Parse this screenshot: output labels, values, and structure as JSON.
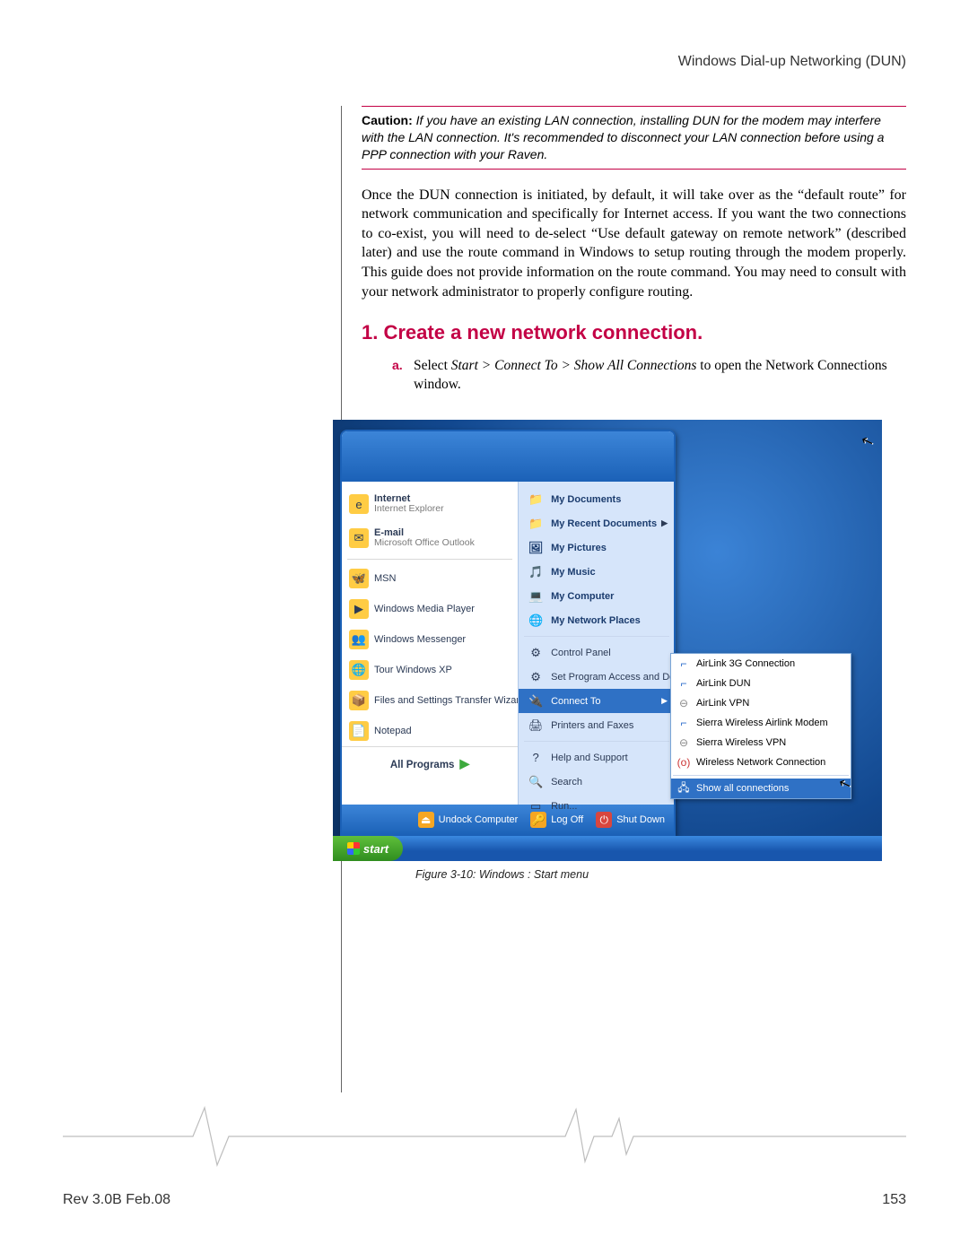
{
  "header": {
    "title": "Windows Dial-up Networking (DUN)"
  },
  "caution": {
    "label": "Caution:",
    "body": "If you have an existing LAN connection, installing DUN for the modem may interfere with the LAN connection. It's recommended to disconnect your LAN connection before using a PPP connection with your Raven."
  },
  "paragraph": "Once the DUN connection is initiated, by default, it will take over as the “default route” for network communication and specifically for Internet access. If you want the two connections to co-exist, you will need to de-select “Use default gateway on remote network” (described later) and use the route command in Windows to setup routing through the modem properly. This guide does not provide information on the route command. You may need to consult with your network administrator to properly configure routing.",
  "section": {
    "number": "1.",
    "title": "Create a new network connection."
  },
  "step_a": {
    "letter": "a.",
    "prefix": "Select ",
    "path": "Start > Connect To > Show All Connections",
    "suffix": " to open the Network Connections window."
  },
  "start_menu": {
    "left_pinned": [
      {
        "title": "Internet",
        "sub": "Internet Explorer",
        "icon": "e"
      },
      {
        "title": "E-mail",
        "sub": "Microsoft Office Outlook",
        "icon": "✉"
      }
    ],
    "left_items": [
      {
        "label": "MSN",
        "icon": "🦋"
      },
      {
        "label": "Windows Media Player",
        "icon": "▶"
      },
      {
        "label": "Windows Messenger",
        "icon": "👥"
      },
      {
        "label": "Tour Windows XP",
        "icon": "🌐"
      },
      {
        "label": "Files and Settings Transfer Wizard",
        "icon": "📦"
      },
      {
        "label": "Notepad",
        "icon": "📄"
      }
    ],
    "all_programs": "All Programs",
    "right_items": [
      {
        "label": "My Documents",
        "bold": true,
        "icon": "📁"
      },
      {
        "label": "My Recent Documents",
        "bold": true,
        "icon": "📁",
        "arrow": true
      },
      {
        "label": "My Pictures",
        "bold": true,
        "icon": "🖼"
      },
      {
        "label": "My Music",
        "bold": true,
        "icon": "🎵"
      },
      {
        "label": "My Computer",
        "bold": true,
        "icon": "💻"
      },
      {
        "label": "My Network Places",
        "bold": true,
        "icon": "🌐"
      },
      {
        "sep": true
      },
      {
        "label": "Control Panel",
        "icon": "⚙"
      },
      {
        "label": "Set Program Access and Defaults",
        "icon": "⚙"
      },
      {
        "label": "Connect To",
        "icon": "🔌",
        "selected": true,
        "arrow": true
      },
      {
        "label": "Printers and Faxes",
        "icon": "🖨"
      },
      {
        "sep": true
      },
      {
        "label": "Help and Support",
        "icon": "?"
      },
      {
        "label": "Search",
        "icon": "🔍"
      },
      {
        "label": "Run...",
        "icon": "▭"
      }
    ],
    "bottom": {
      "undock": "Undock Computer",
      "logoff": "Log Off",
      "shutdown": "Shut Down"
    }
  },
  "flyout": [
    {
      "label": "AirLink 3G Connection",
      "type": "dun"
    },
    {
      "label": "AirLink DUN",
      "type": "dun"
    },
    {
      "label": "AirLink VPN",
      "type": "vpn"
    },
    {
      "label": "Sierra Wireless Airlink Modem",
      "type": "dun"
    },
    {
      "label": "Sierra Wireless VPN",
      "type": "vpn"
    },
    {
      "label": "Wireless Network Connection",
      "type": "wifi"
    },
    {
      "sep": true
    },
    {
      "label": "Show all connections",
      "type": "net",
      "selected": true
    }
  ],
  "start_button": "start",
  "figure_caption": "Figure 3-10:  Windows : Start menu",
  "footer": {
    "rev": "Rev 3.0B Feb.08",
    "page": "153"
  }
}
